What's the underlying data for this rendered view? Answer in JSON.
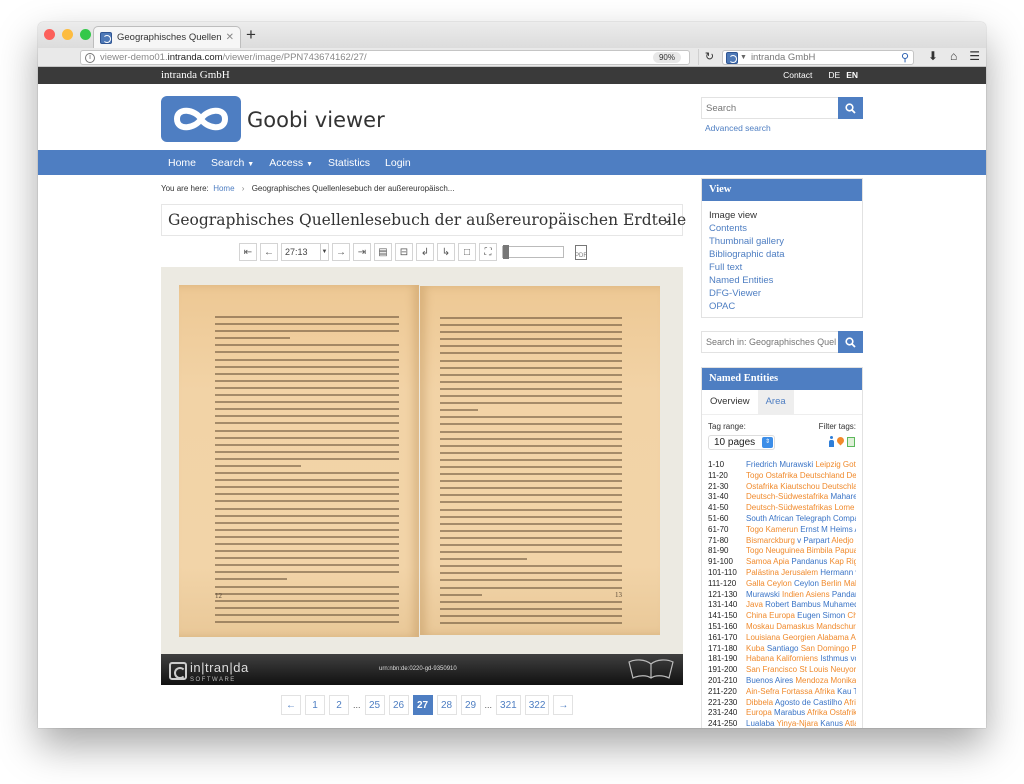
{
  "browser": {
    "tab_title": "Geographisches Quellenlesebu",
    "url_prefix": "viewer-demo01.",
    "url_host": "intranda.com",
    "url_path": "/viewer/image/PPN743674162/27/",
    "zoom_level": "90%",
    "search_engine": "intranda GmbH"
  },
  "topbar": {
    "brand": "intranda GmbH",
    "contact": "Contact",
    "lang_de": "DE",
    "lang_en": "EN"
  },
  "header": {
    "site_title": "Goobi viewer",
    "search_placeholder": "Search",
    "advanced_search": "Advanced search"
  },
  "nav": {
    "items": [
      "Home",
      "Search",
      "Access",
      "Statistics",
      "Login"
    ]
  },
  "breadcrumb": {
    "prefix": "You are here:",
    "home": "Home",
    "current": "Geographisches Quellenlesebuch der außereuropäisch..."
  },
  "record": {
    "title": "Geographisches Quellenlesebuch der außereuropäischen Erdteile"
  },
  "toolbar": {
    "page_select_value": "27:13",
    "zoom_fraction": 0.1,
    "icons": [
      "first-page",
      "previous-page",
      "next-page",
      "last-page",
      "single-page-view",
      "double-page-view",
      "rotate-left",
      "rotate-right",
      "reset-view",
      "fullscreen",
      "pdf-download"
    ]
  },
  "viewer": {
    "left_page_number": "12",
    "right_page_number": "13",
    "urn": "urn:nbn:de:0220-gd-9350910",
    "footer_logo_word": "in|tran|da",
    "footer_logo_sub": "SOFTWARE"
  },
  "pagination": {
    "prev": "←",
    "next": "→",
    "ellipsis": "...",
    "pages_before": [
      "1",
      "2"
    ],
    "pages_middle": [
      "25",
      "26",
      "27",
      "28",
      "29"
    ],
    "pages_after": [
      "321",
      "322"
    ],
    "current": "27"
  },
  "sidebar": {
    "view": {
      "heading": "View",
      "items": [
        "Image view",
        "Contents",
        "Thumbnail gallery",
        "Bibliographic data",
        "Full text",
        "Named Entities",
        "DFG-Viewer",
        "OPAC"
      ],
      "current": "Image view"
    },
    "search_in_placeholder": "Search in: Geographisches Quel",
    "named_entities": {
      "heading": "Named Entities",
      "tabs": [
        "Overview",
        "Area"
      ],
      "active_tab": "Area",
      "tag_range_label": "Tag range:",
      "tag_range_value": "10 pages",
      "filter_tags_label": "Filter tags:",
      "filter_tags": [
        "person",
        "location",
        "other"
      ],
      "colors": {
        "person": "#3a74c6",
        "location": "#f08a2c"
      },
      "rows": [
        {
          "range": "1-10",
          "tags": [
            [
              "Friedrich Murawski",
              "b"
            ],
            [
              "Leipzig",
              "o"
            ],
            [
              "Gotha",
              "o"
            ]
          ]
        },
        {
          "range": "11-20",
          "tags": [
            [
              "Togo",
              "o"
            ],
            [
              "Ostafrika",
              "o"
            ],
            [
              "Deutschland",
              "o"
            ],
            [
              "Deutschland",
              "o"
            ]
          ]
        },
        {
          "range": "21-30",
          "tags": [
            [
              "Ostafrika",
              "o"
            ],
            [
              "Kiautschou",
              "o"
            ],
            [
              "Deutschland",
              "o"
            ]
          ]
        },
        {
          "range": "31-40",
          "tags": [
            [
              "Deutsch-Südwestafrika",
              "o"
            ],
            [
              "Maharero",
              "b"
            ]
          ]
        },
        {
          "range": "41-50",
          "tags": [
            [
              "Deutsch-Südwestafrikas",
              "o"
            ],
            [
              "Lome",
              "o"
            ],
            [
              "O",
              "o"
            ]
          ]
        },
        {
          "range": "51-60",
          "tags": [
            [
              "South African Telegraph Company",
              "b"
            ]
          ]
        },
        {
          "range": "61-70",
          "tags": [
            [
              "Togo",
              "o"
            ],
            [
              "Kamerun",
              "o"
            ],
            [
              "Ernst M Heims",
              "b"
            ],
            [
              "Ac",
              "b"
            ]
          ]
        },
        {
          "range": "71-80",
          "tags": [
            [
              "Bismarckburg",
              "o"
            ],
            [
              "v Parpart",
              "b"
            ],
            [
              "Aledjo",
              "o"
            ],
            [
              "v",
              "b"
            ]
          ]
        },
        {
          "range": "81-90",
          "tags": [
            [
              "Togo",
              "o"
            ],
            [
              "Neuguinea",
              "o"
            ],
            [
              "Bimbila",
              "o"
            ],
            [
              "Papua",
              "o"
            ],
            [
              "S",
              "o"
            ]
          ]
        },
        {
          "range": "91-100",
          "tags": [
            [
              "Samoa",
              "o"
            ],
            [
              "Apia",
              "o"
            ],
            [
              "Pandanus",
              "b"
            ],
            [
              "Kap Rigny",
              "o"
            ]
          ]
        },
        {
          "range": "101-110",
          "tags": [
            [
              "Palästina",
              "o"
            ],
            [
              "Jerusalem",
              "o"
            ],
            [
              "Hermann v W",
              "b"
            ]
          ]
        },
        {
          "range": "111-120",
          "tags": [
            [
              "Galla",
              "o"
            ],
            [
              "Ceylon",
              "o"
            ],
            [
              "Ceylon",
              "b"
            ],
            [
              "Berlin",
              "o"
            ],
            [
              "Mahir",
              "o"
            ]
          ]
        },
        {
          "range": "121-130",
          "tags": [
            [
              "Murawski",
              "b"
            ],
            [
              "Indien",
              "o"
            ],
            [
              "Asiens",
              "o"
            ],
            [
              "Pandanus",
              "b"
            ]
          ]
        },
        {
          "range": "131-140",
          "tags": [
            [
              "Java",
              "o"
            ],
            [
              "Robert Bambus",
              "b"
            ],
            [
              "Muhamed I",
              "b"
            ]
          ]
        },
        {
          "range": "141-150",
          "tags": [
            [
              "China",
              "o"
            ],
            [
              "Europa",
              "o"
            ],
            [
              "Eugen Simon",
              "b"
            ],
            [
              "China",
              "o"
            ]
          ]
        },
        {
          "range": "151-160",
          "tags": [
            [
              "Moskau",
              "o"
            ],
            [
              "Damaskus",
              "o"
            ],
            [
              "Mandschuria",
              "o"
            ]
          ]
        },
        {
          "range": "161-170",
          "tags": [
            [
              "Louisiana",
              "o"
            ],
            [
              "Georgien",
              "o"
            ],
            [
              "Alabama",
              "o"
            ],
            [
              "Ala",
              "o"
            ]
          ]
        },
        {
          "range": "171-180",
          "tags": [
            [
              "Kuba",
              "o"
            ],
            [
              "Santiago",
              "b"
            ],
            [
              "San Domingo",
              "o"
            ],
            [
              "Pue",
              "o"
            ]
          ]
        },
        {
          "range": "181-190",
          "tags": [
            [
              "Habana",
              "o"
            ],
            [
              "Kaliforniens",
              "o"
            ],
            [
              "Isthmus von",
              "b"
            ]
          ]
        },
        {
          "range": "191-200",
          "tags": [
            [
              "San Francisco",
              "o"
            ],
            [
              "St Louis",
              "o"
            ],
            [
              "Neuyork",
              "o"
            ],
            [
              "F",
              "o"
            ]
          ]
        },
        {
          "range": "201-210",
          "tags": [
            [
              "Buenos Aires",
              "b"
            ],
            [
              "Mendoza",
              "o"
            ],
            [
              "Monika",
              "o"
            ],
            [
              "R",
              "o"
            ]
          ]
        },
        {
          "range": "211-220",
          "tags": [
            [
              "Ain-Sefra",
              "o"
            ],
            [
              "Fortassa",
              "o"
            ],
            [
              "Afrika",
              "o"
            ],
            [
              "Kau Tic",
              "b"
            ]
          ]
        },
        {
          "range": "221-230",
          "tags": [
            [
              "Dibbela",
              "o"
            ],
            [
              "Agosto de Castilho",
              "b"
            ],
            [
              "Afrika",
              "o"
            ]
          ]
        },
        {
          "range": "231-240",
          "tags": [
            [
              "Europa",
              "o"
            ],
            [
              "Marabus",
              "b"
            ],
            [
              "Afrika",
              "o"
            ],
            [
              "Ostafrika",
              "o"
            ]
          ]
        },
        {
          "range": "241-250",
          "tags": [
            [
              "Lualaba",
              "b"
            ],
            [
              "Yinya-Njara",
              "o"
            ],
            [
              "Kanus",
              "b"
            ],
            [
              "Atlan",
              "o"
            ]
          ]
        }
      ]
    }
  }
}
